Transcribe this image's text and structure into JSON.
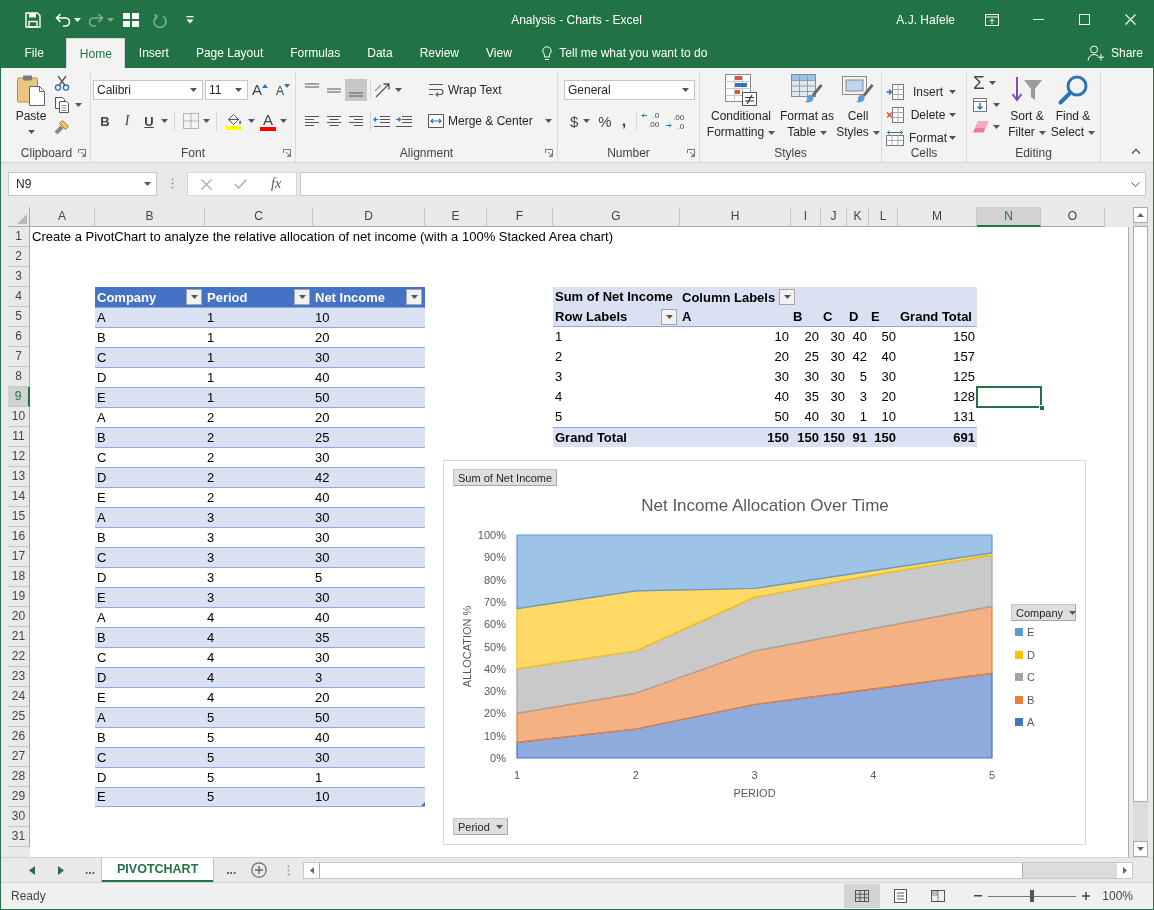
{
  "window": {
    "title": "Analysis - Charts - Excel",
    "user": "A.J. Hafele"
  },
  "quick_access": [
    {
      "kind": "save",
      "disabled": false
    },
    {
      "kind": "undo",
      "disabled": false
    },
    {
      "kind": "redo",
      "disabled": true
    },
    {
      "kind": "form",
      "disabled": false
    },
    {
      "kind": "refresh",
      "disabled": true
    },
    {
      "kind": "customize",
      "disabled": false
    }
  ],
  "ribbon_tabs": [
    {
      "label": "File",
      "selected": false
    },
    {
      "label": "Home",
      "selected": true
    },
    {
      "label": "Insert",
      "selected": false
    },
    {
      "label": "Page Layout",
      "selected": false
    },
    {
      "label": "Formulas",
      "selected": false
    },
    {
      "label": "Data",
      "selected": false
    },
    {
      "label": "Review",
      "selected": false
    },
    {
      "label": "View",
      "selected": false
    }
  ],
  "tell_me": "Tell me what you want to do",
  "share": "Share",
  "ribbon": {
    "clipboard": {
      "label": "Clipboard",
      "paste": "Paste"
    },
    "font": {
      "label": "Font",
      "font_name": "Calibri",
      "font_size": "11",
      "grow": "A",
      "shrink": "A",
      "styles": [
        {
          "kind": "bold",
          "label": "B"
        },
        {
          "kind": "italic",
          "label": "I"
        },
        {
          "kind": "underline",
          "label": "U"
        }
      ],
      "fill": {
        "color": "#ffff00"
      },
      "font_color": {
        "label": "A",
        "color": "#ff0000"
      }
    },
    "alignment": {
      "label": "Alignment",
      "vertical": [
        {
          "kind": "top",
          "selected": false
        },
        {
          "kind": "middle",
          "selected": false
        },
        {
          "kind": "bottom",
          "selected": true
        }
      ],
      "horizontal": [
        {
          "kind": "left",
          "selected": false
        },
        {
          "kind": "center",
          "selected": false
        },
        {
          "kind": "right",
          "selected": false
        }
      ],
      "wrap_text": "Wrap Text",
      "merge_center": "Merge & Center"
    },
    "number": {
      "label": "Number",
      "format": "General",
      "symbols": [
        {
          "kind": "currency",
          "label": "$"
        },
        {
          "kind": "percent",
          "label": "%"
        },
        {
          "kind": "comma",
          "label": ","
        }
      ],
      "decimals": [
        {
          "kind": "increase",
          "label": ".0\n.00"
        },
        {
          "kind": "decrease",
          "label": ".00\n.0"
        }
      ]
    },
    "styles": {
      "label": "Styles",
      "buttons": [
        {
          "kind": "conditional",
          "label": "Conditional\nFormatting"
        },
        {
          "kind": "table",
          "label": "Format as\nTable"
        },
        {
          "kind": "cell",
          "label": "Cell\nStyles"
        }
      ]
    },
    "cells": {
      "label": "Cells",
      "buttons": [
        {
          "kind": "insert",
          "label": "Insert"
        },
        {
          "kind": "delete",
          "label": "Delete"
        },
        {
          "kind": "format",
          "label": "Format"
        }
      ]
    },
    "editing": {
      "label": "Editing",
      "autosum": "Σ",
      "buttons": [
        {
          "kind": "sort",
          "label": "Sort &\nFilter"
        },
        {
          "kind": "find",
          "label": "Find &\nSelect"
        }
      ]
    }
  },
  "formula_bar": {
    "name_box": "N9",
    "function_button": "fx"
  },
  "sheet": {
    "column_headers": [
      {
        "label": "A",
        "selected": false
      },
      {
        "label": "B",
        "selected": false
      },
      {
        "label": "C",
        "selected": false
      },
      {
        "label": "D",
        "selected": false
      },
      {
        "label": "E",
        "selected": false
      },
      {
        "label": "F",
        "selected": false
      },
      {
        "label": "G",
        "selected": false
      },
      {
        "label": "H",
        "selected": false
      },
      {
        "label": "I",
        "selected": false
      },
      {
        "label": "J",
        "selected": false
      },
      {
        "label": "K",
        "selected": false
      },
      {
        "label": "L",
        "selected": false
      },
      {
        "label": "M",
        "selected": false
      },
      {
        "label": "N",
        "selected": true
      },
      {
        "label": "O",
        "selected": false
      }
    ],
    "row_headers": [
      {
        "label": "1",
        "selected": false
      },
      {
        "label": "2",
        "selected": false
      },
      {
        "label": "3",
        "selected": false
      },
      {
        "label": "4",
        "selected": false
      },
      {
        "label": "5",
        "selected": false
      },
      {
        "label": "6",
        "selected": false
      },
      {
        "label": "7",
        "selected": false
      },
      {
        "label": "8",
        "selected": false
      },
      {
        "label": "9",
        "selected": true
      },
      {
        "label": "10",
        "selected": false
      },
      {
        "label": "11",
        "selected": false
      },
      {
        "label": "12",
        "selected": false
      },
      {
        "label": "13",
        "selected": false
      },
      {
        "label": "14",
        "selected": false
      },
      {
        "label": "15",
        "selected": false
      },
      {
        "label": "16",
        "selected": false
      },
      {
        "label": "17",
        "selected": false
      },
      {
        "label": "18",
        "selected": false
      },
      {
        "label": "19",
        "selected": false
      },
      {
        "label": "20",
        "selected": false
      },
      {
        "label": "21",
        "selected": false
      },
      {
        "label": "22",
        "selected": false
      },
      {
        "label": "23",
        "selected": false
      },
      {
        "label": "24",
        "selected": false
      },
      {
        "label": "25",
        "selected": false
      },
      {
        "label": "26",
        "selected": false
      },
      {
        "label": "27",
        "selected": false
      },
      {
        "label": "28",
        "selected": false
      },
      {
        "label": "29",
        "selected": false
      },
      {
        "label": "30",
        "selected": false
      },
      {
        "label": "31",
        "selected": false
      }
    ],
    "instruction": "Create a PivotChart to analyze the relative allocation of net income (with a 100% Stacked Area chart)",
    "data_table": {
      "columns": [
        "Company",
        "Period",
        "Net Income"
      ],
      "rows": [
        [
          "A",
          "1",
          "10"
        ],
        [
          "B",
          "1",
          "20"
        ],
        [
          "C",
          "1",
          "30"
        ],
        [
          "D",
          "1",
          "40"
        ],
        [
          "E",
          "1",
          "50"
        ],
        [
          "A",
          "2",
          "20"
        ],
        [
          "B",
          "2",
          "25"
        ],
        [
          "C",
          "2",
          "30"
        ],
        [
          "D",
          "2",
          "42"
        ],
        [
          "E",
          "2",
          "40"
        ],
        [
          "A",
          "3",
          "30"
        ],
        [
          "B",
          "3",
          "30"
        ],
        [
          "C",
          "3",
          "30"
        ],
        [
          "D",
          "3",
          "5"
        ],
        [
          "E",
          "3",
          "30"
        ],
        [
          "A",
          "4",
          "40"
        ],
        [
          "B",
          "4",
          "35"
        ],
        [
          "C",
          "4",
          "30"
        ],
        [
          "D",
          "4",
          "3"
        ],
        [
          "E",
          "4",
          "20"
        ],
        [
          "A",
          "5",
          "50"
        ],
        [
          "B",
          "5",
          "40"
        ],
        [
          "C",
          "5",
          "30"
        ],
        [
          "D",
          "5",
          "1"
        ],
        [
          "E",
          "5",
          "10"
        ]
      ]
    },
    "pivot_table": {
      "value_field": "Sum of Net Income",
      "column_field": "Column Labels",
      "row_field": "Row Labels",
      "columns": [
        "A",
        "B",
        "C",
        "D",
        "E",
        "Grand Total"
      ],
      "rows": [
        {
          "label": "1",
          "values": [
            "10",
            "20",
            "30",
            "40",
            "50",
            "150"
          ]
        },
        {
          "label": "2",
          "values": [
            "20",
            "25",
            "30",
            "42",
            "40",
            "157"
          ]
        },
        {
          "label": "3",
          "values": [
            "30",
            "30",
            "30",
            "5",
            "30",
            "125"
          ]
        },
        {
          "label": "4",
          "values": [
            "40",
            "35",
            "30",
            "3",
            "20",
            "128"
          ]
        },
        {
          "label": "5",
          "values": [
            "50",
            "40",
            "30",
            "1",
            "10",
            "131"
          ]
        }
      ],
      "total": {
        "label": "Grand Total",
        "values": [
          "150",
          "150",
          "150",
          "91",
          "150",
          "691"
        ]
      }
    },
    "chart": {
      "value_button": "Sum of Net Income",
      "axis_button": "Period",
      "legend_button": "Company",
      "chart_data": {
        "type": "area",
        "title": "Net Income Allocation Over Time",
        "xlabel": "PERIOD",
        "ylabel": "ALLOCATION %",
        "categories": [
          "1",
          "2",
          "3",
          "4",
          "5"
        ],
        "series": [
          {
            "name": "A",
            "color": "#4472c4",
            "values": [
              7,
              13,
              24,
              31,
              38
            ]
          },
          {
            "name": "B",
            "color": "#ed7d31",
            "values": [
              13,
              16,
              24,
              27,
              30
            ]
          },
          {
            "name": "C",
            "color": "#a5a5a5",
            "values": [
              20,
              19,
              24,
              24,
              23
            ]
          },
          {
            "name": "D",
            "color": "#ffc000",
            "values": [
              27,
              27,
              4,
              2,
              1
            ]
          },
          {
            "name": "E",
            "color": "#5b9bd5",
            "values": [
              33,
              25,
              24,
              16,
              8
            ]
          }
        ],
        "stacked": true,
        "legend": "right",
        "ylim": [
          0,
          100
        ],
        "yticks": [
          {
            "value": 0,
            "label": "0%"
          },
          {
            "value": 10,
            "label": "10%"
          },
          {
            "value": 20,
            "label": "20%"
          },
          {
            "value": 30,
            "label": "30%"
          },
          {
            "value": 40,
            "label": "40%"
          },
          {
            "value": 50,
            "label": "50%"
          },
          {
            "value": 60,
            "label": "60%"
          },
          {
            "value": 70,
            "label": "70%"
          },
          {
            "value": 80,
            "label": "80%"
          },
          {
            "value": 90,
            "label": "90%"
          },
          {
            "value": 100,
            "label": "100%"
          }
        ]
      }
    }
  },
  "sheet_tabs": {
    "before": "...",
    "tabs": [
      {
        "label": "PIVOTCHART",
        "selected": true
      }
    ],
    "after": "..."
  },
  "status_bar": {
    "status": "Ready",
    "views": [
      {
        "kind": "normal",
        "selected": true
      },
      {
        "kind": "page_layout",
        "selected": false
      },
      {
        "kind": "page_break",
        "selected": false
      }
    ],
    "zoom": {
      "level": 0.5,
      "reading": "100%"
    }
  }
}
